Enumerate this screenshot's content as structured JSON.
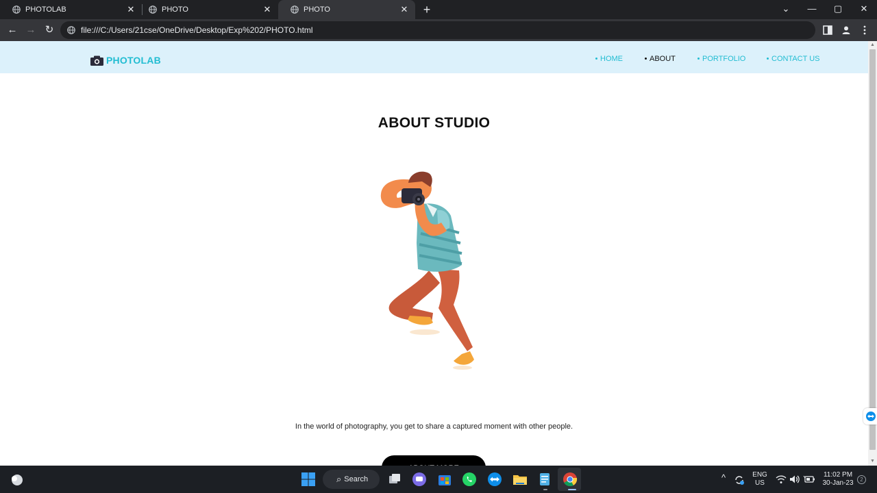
{
  "browser": {
    "tabs": [
      {
        "title": "PHOTOLAB",
        "close": "✕"
      },
      {
        "title": "PHOTO",
        "close": "✕"
      },
      {
        "title": "PHOTO",
        "close": "✕"
      }
    ],
    "new_tab": "+",
    "window_controls": {
      "dropdown": "⌄",
      "minimize": "—",
      "maximize": "▢",
      "close": "✕"
    },
    "url": "file:///C:/Users/21cse/OneDrive/Desktop/Exp%202/PHOTO.html",
    "back": "←",
    "forward": "→",
    "reload": "↻"
  },
  "site": {
    "brand": "PHOTOLAB",
    "nav": [
      "HOME",
      "ABOUT",
      "PORTFOLIO",
      "CONTACT US"
    ],
    "active_nav": "ABOUT",
    "heading": "ABOUT STUDIO",
    "description": "In the world of photography, you get to share a captured moment with other people.",
    "button": "ABOUT MORE"
  },
  "scrollbar": {
    "up": "▲",
    "down": "▼"
  },
  "taskbar": {
    "search_label": "Search",
    "search_icon": "⌕",
    "tray_chevron": "^",
    "language": "ENG",
    "region": "US",
    "time": "11:02 PM",
    "date": "30-Jan-23",
    "notification_count": "2"
  },
  "colors": {
    "accent": "#22bdd2",
    "navbar_bg": "#dcf1fb",
    "button_bg": "#000000"
  }
}
